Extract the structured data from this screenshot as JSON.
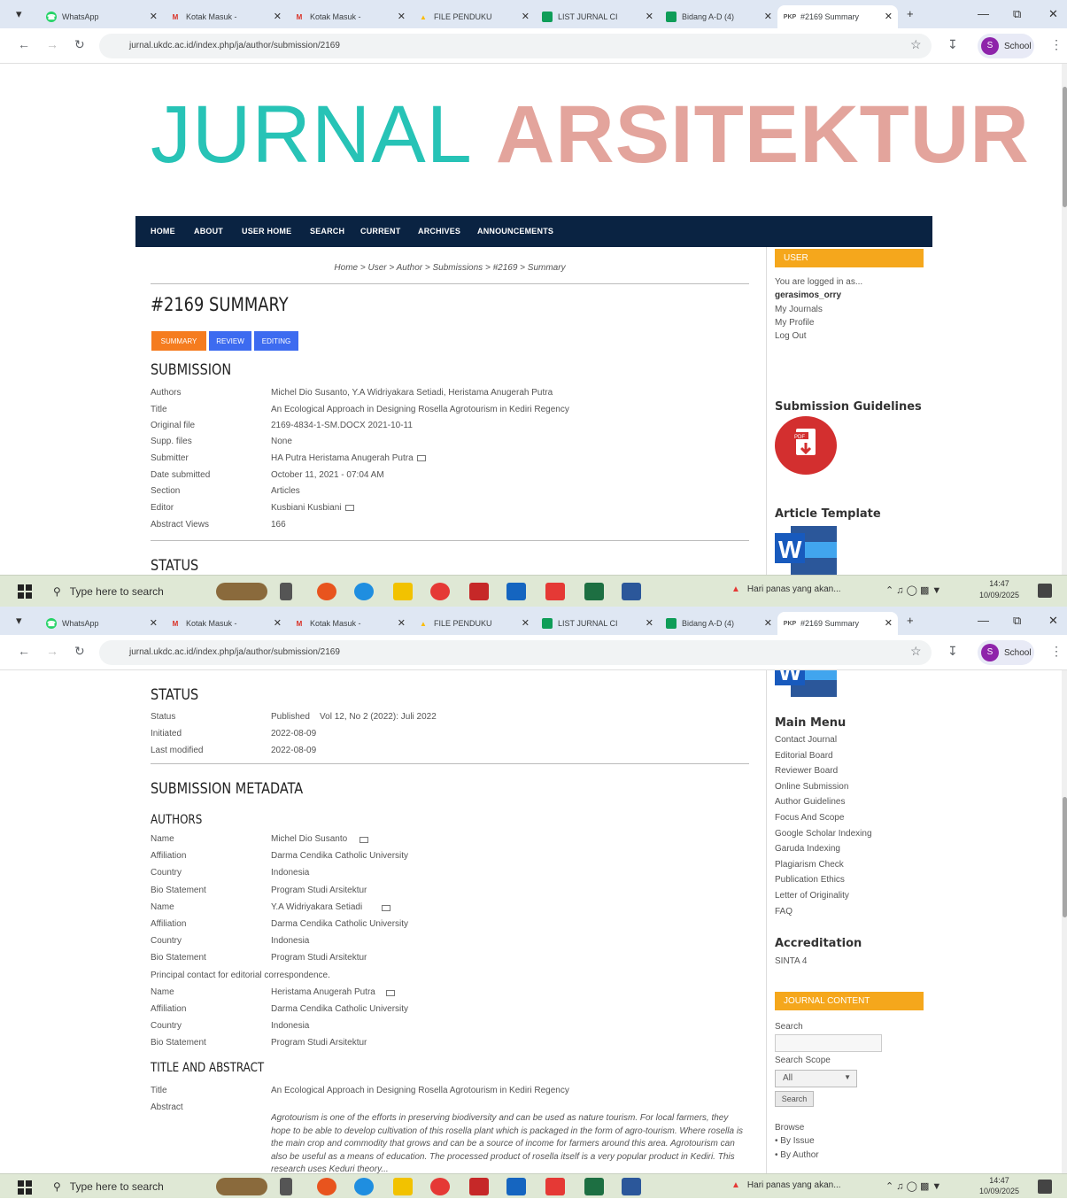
{
  "browser": {
    "tabs": [
      {
        "label": "WhatsApp",
        "icon": "whatsapp-icon",
        "color": "#25d366"
      },
      {
        "label": "Kotak Masuk - ",
        "icon": "gmail-icon",
        "color": "#d93025"
      },
      {
        "label": "Kotak Masuk - ",
        "icon": "gmail-icon",
        "color": "#d93025"
      },
      {
        "label": "FILE PENDUKU",
        "icon": "drive-icon",
        "color": "#fbbc04"
      },
      {
        "label": "LIST JURNAL CI",
        "icon": "sheets-icon",
        "color": "#0f9d58"
      },
      {
        "label": "Bidang A-D (4)",
        "icon": "sheets-icon",
        "color": "#0f9d58"
      },
      {
        "label": "#2169 Summary",
        "icon": "pdf-tab-icon",
        "color": "#555555"
      }
    ],
    "url": "jurnal.ukdc.ac.id/index.php/ja/author/submission/2169",
    "profile_label": "School",
    "profile_initial": "S"
  },
  "taskbar": {
    "search_placeholder": "Type here to search",
    "weather": "Hari panas yang akan...",
    "time": "14:47",
    "date": "10/09/2025"
  },
  "journal": {
    "title_part1": "JURNAL",
    "title_part2": "ARSITEKTUR",
    "color1": "#27c3b6",
    "color2": "#e3a49c",
    "menu": [
      "HOME",
      "ABOUT",
      "USER HOME",
      "SEARCH",
      "CURRENT",
      "ARCHIVES",
      "ANNOUNCEMENTS"
    ]
  },
  "breadcrumb": "Home > User > Author > Submissions > #2169 > Summary",
  "page_title": "#2169 SUMMARY",
  "tabs": [
    "SUMMARY",
    "REVIEW",
    "EDITING"
  ],
  "submission": {
    "heading": "SUBMISSION",
    "rows": [
      {
        "k": "Authors",
        "v": "Michel Dio Susanto, Y.A Widriyakara Setiadi, Heristama Anugerah Putra"
      },
      {
        "k": "Title",
        "v": "An Ecological Approach in Designing Rosella Agrotourism in Kediri Regency"
      },
      {
        "k": "Original file",
        "v": "2169-4834-1-SM.DOCX  2021-10-11"
      },
      {
        "k": "Supp. files",
        "v": "None"
      },
      {
        "k": "Submitter",
        "v": "HA Putra Heristama Anugerah Putra"
      },
      {
        "k": "Date submitted",
        "v": "October 11, 2021 - 07:04 AM"
      },
      {
        "k": "Section",
        "v": "Articles"
      },
      {
        "k": "Editor",
        "v": "Kusbiani Kusbiani"
      },
      {
        "k": "Abstract Views",
        "v": "166"
      }
    ]
  },
  "status": {
    "heading": "STATUS",
    "rows": [
      {
        "k": "Status",
        "v": "Published    Vol 12, No 2 (2022): Juli 2022"
      },
      {
        "k": "Initiated",
        "v": "2022-08-09"
      },
      {
        "k": "Last modified",
        "v": "2022-08-09"
      }
    ]
  },
  "metadata": {
    "heading": "SUBMISSION METADATA",
    "authors_heading": "AUTHORS",
    "rows": [
      {
        "k": "Name",
        "v": "Michel Dio Susanto"
      },
      {
        "k": "Affiliation",
        "v": "Darma Cendika Catholic University"
      },
      {
        "k": "Country",
        "v": "Indonesia"
      },
      {
        "k": "Bio Statement",
        "v": "Program Studi Arsitektur"
      },
      {
        "k": "Name",
        "v": "Y.A Widriyakara Setiadi"
      },
      {
        "k": "Affiliation",
        "v": "Darma Cendika Catholic University"
      },
      {
        "k": "Country",
        "v": "Indonesia"
      },
      {
        "k": "Bio Statement",
        "v": "Program Studi Arsitektur"
      },
      {
        "k": "Principal contact for editorial correspondence.",
        "v": ""
      },
      {
        "k": "Name",
        "v": "Heristama Anugerah Putra"
      },
      {
        "k": "Affiliation",
        "v": "Darma Cendika Catholic University"
      },
      {
        "k": "Country",
        "v": "Indonesia"
      },
      {
        "k": "Bio Statement",
        "v": "Program Studi Arsitektur"
      }
    ],
    "title_abstract_heading": "TITLE AND ABSTRACT",
    "title_label": "Title",
    "title_value": "An Ecological Approach in Designing Rosella Agrotourism in Kediri Regency",
    "abstract_label": "Abstract",
    "abstract": "Agrotourism is one of the efforts in preserving biodiversity and can be used as nature tourism. For local farmers, they hope to be able to develop cultivation of this rosella plant which is packaged in the form of agro-tourism. Where rosella is the main crop and commodity that grows and can be a source of income for farmers around this area. Agrotourism can also be useful as a means of education. The processed product of rosella itself is a very popular product in Kediri. This research uses Keduri theory..."
  },
  "sidebar": {
    "user_heading": "USER",
    "logged_in_as": "You are logged in as...",
    "username": "gerasimos_orry",
    "user_links": [
      "My Journals",
      "My Profile",
      "Log Out"
    ],
    "guidelines_heading": "Submission Guidelines",
    "template_heading": "Article Template",
    "main_menu_heading": "Main Menu",
    "main_menu": [
      "Contact Journal",
      "Editorial Board",
      "Reviewer Board",
      "Online Submission",
      "Author Guidelines",
      "Focus And Scope",
      "Google Scholar Indexing",
      "Garuda Indexing",
      "Plagiarism Check",
      "Publication Ethics",
      "Letter of Originality",
      "FAQ"
    ],
    "accreditation_heading": "Accreditation",
    "accreditation": "SINTA 4",
    "journal_content_heading": "JOURNAL CONTENT",
    "search_label": "Search",
    "search_scope_label": "Search Scope",
    "search_scope_value": "All",
    "search_button": "Search",
    "browse_label": "Browse",
    "browse_links": [
      "By Issue",
      "By Author"
    ]
  }
}
